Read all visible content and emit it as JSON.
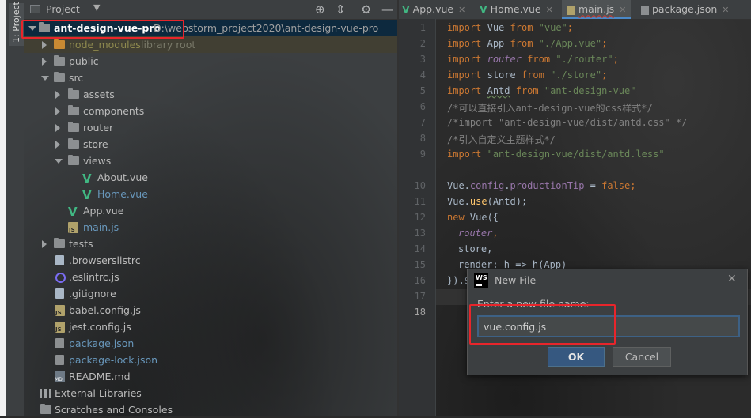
{
  "tool_window": {
    "stripe_label": "1: Project"
  },
  "project_panel": {
    "title": "Project",
    "root": {
      "name": "ant-design-vue-pro",
      "path": "D:\\webstorm_project2020\\ant-design-vue-pro"
    },
    "node_modules": {
      "name": "node_modules",
      "hint": "library root"
    },
    "items": {
      "public": "public",
      "src": "src",
      "assets": "assets",
      "components": "components",
      "router": "router",
      "store": "store",
      "views": "views",
      "about": "About.vue",
      "home": "Home.vue",
      "app": "App.vue",
      "main": "main.js",
      "tests": "tests",
      "browserslistrc": ".browserslistrc",
      "eslintrc": ".eslintrc.js",
      "gitignore": ".gitignore",
      "babel": "babel.config.js",
      "jest": "jest.config.js",
      "package": "package.json",
      "package_lock": "package-lock.json",
      "readme": "README.md",
      "external": "External Libraries",
      "scratches": "Scratches and Consoles"
    }
  },
  "editor": {
    "tabs": [
      {
        "label": "App.vue"
      },
      {
        "label": "Home.vue"
      },
      {
        "label": "main.js"
      },
      {
        "label": "package.json"
      }
    ],
    "line_numbers": [
      "1",
      "2",
      "3",
      "4",
      "5",
      "6",
      "7",
      "8",
      "9",
      "10",
      "11",
      "12",
      "13",
      "14",
      "15",
      "16",
      "17",
      "18"
    ],
    "code": {
      "l1": [
        "import",
        "Vue",
        "from",
        "\"vue\"",
        ";"
      ],
      "l2": [
        "import",
        "App",
        "from",
        "\"./App.vue\"",
        ";"
      ],
      "l3": [
        "import",
        "router",
        "from",
        "\"./router\"",
        ";"
      ],
      "l4": [
        "import",
        "store",
        "from",
        "\"./store\"",
        ";"
      ],
      "l5": [
        "import",
        "Antd",
        "from",
        "\"ant-design-vue\""
      ],
      "l6": "/*可以直接引入ant-design-vue的css样式*/",
      "l7": "/*import \"ant-design-vue/dist/antd.css\" */",
      "l8": "/*引入自定义主题样式*/",
      "l9": [
        "import",
        "\"ant-design-vue/dist/antd.less\""
      ],
      "l11": [
        "Vue.",
        "config",
        ".",
        "productionTip",
        " = ",
        "false",
        ";"
      ],
      "l12": [
        "Vue.",
        "use",
        "(Antd);"
      ],
      "l13": [
        "new",
        " Vue({"
      ],
      "l14": [
        "router",
        ","
      ],
      "l15": "store,",
      "l16": "render: h => h(App)",
      "l17": "}).$"
    }
  },
  "dialog": {
    "title": "New File",
    "prompt": "Enter a new file name:",
    "input_value": "vue.config.js",
    "ok_label": "OK",
    "cancel_label": "Cancel"
  },
  "colors": {
    "accent": "#4a88c7",
    "annotation": "#e8252b",
    "vue_green": "#41b883"
  }
}
